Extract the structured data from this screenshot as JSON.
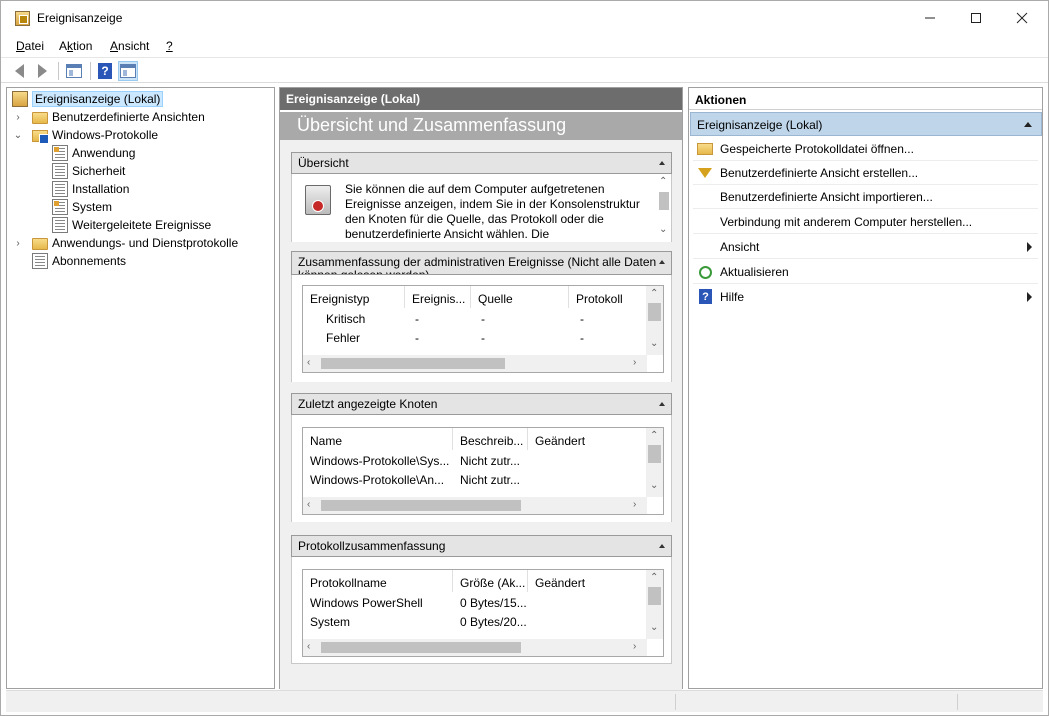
{
  "window": {
    "title": "Ereignisanzeige"
  },
  "menu": {
    "items": [
      {
        "label": "Datei",
        "ul": "D"
      },
      {
        "label": "Aktion",
        "ul": "k"
      },
      {
        "label": "Ansicht",
        "ul": "A"
      },
      {
        "label": "?",
        "ul": "?"
      }
    ]
  },
  "toolbar": {
    "icons": [
      "back-arrow-icon",
      "forward-arrow-icon",
      "show-hide-console-tree-icon",
      "help-icon",
      "show-hide-action-pane-icon"
    ]
  },
  "tree": {
    "root": "Ereignisanzeige (Lokal)",
    "custom_views": "Benutzerdefinierte Ansichten",
    "windows_logs": "Windows-Protokolle",
    "logs": [
      "Anwendung",
      "Sicherheit",
      "Installation",
      "System",
      "Weitergeleitete Ereignisse"
    ],
    "app_service_logs": "Anwendungs- und Dienstprotokolle",
    "subscriptions": "Abonnements"
  },
  "middle": {
    "header": "Ereignisanzeige (Lokal)",
    "title": "Übersicht und Zusammenfassung",
    "overview": {
      "title": "Übersicht",
      "text": "Sie können die auf dem Computer aufgetretenen Ereignisse anzeigen, indem Sie in der Konsolenstruktur den Knoten für die Quelle, das Protokoll oder die benutzerdefinierte Ansicht wählen. Die"
    },
    "admin_summary": {
      "title": "Zusammenfassung der administrativen Ereignisse (Nicht alle Daten können gelesen werden)",
      "columns": [
        "Ereignistyp",
        "Ereignis...",
        "Quelle",
        "Protokoll"
      ],
      "rows": [
        [
          "Kritisch",
          "-",
          "-",
          "-"
        ],
        [
          "Fehler",
          "-",
          "-",
          "-"
        ]
      ]
    },
    "recent_nodes": {
      "title": "Zuletzt angezeigte Knoten",
      "columns": [
        "Name",
        "Beschreib...",
        "Geändert"
      ],
      "rows": [
        [
          "Windows-Protokolle\\Sys...",
          "Nicht zutr...",
          ""
        ],
        [
          "Windows-Protokolle\\An...",
          "Nicht zutr...",
          ""
        ]
      ]
    },
    "log_summary": {
      "title": "Protokollzusammenfassung",
      "columns": [
        "Protokollname",
        "Größe (Ak...",
        "Geändert"
      ],
      "rows": [
        [
          "Windows PowerShell",
          "0 Bytes/15...",
          ""
        ],
        [
          "System",
          "0 Bytes/20...",
          ""
        ]
      ]
    }
  },
  "actions": {
    "header": "Aktionen",
    "group": "Ereignisanzeige (Lokal)",
    "items": [
      {
        "label": "Gespeicherte Protokolldatei öffnen...",
        "icon": "open-folder-icon",
        "submenu": false
      },
      {
        "label": "Benutzerdefinierte Ansicht erstellen...",
        "icon": "filter-icon",
        "submenu": false
      },
      {
        "label": "Benutzerdefinierte Ansicht importieren...",
        "icon": "",
        "submenu": false
      },
      {
        "label": "Verbindung mit anderem Computer herstellen...",
        "icon": "",
        "submenu": false
      },
      {
        "label": "Ansicht",
        "icon": "",
        "submenu": true
      },
      {
        "label": "Aktualisieren",
        "icon": "refresh-icon",
        "submenu": false
      },
      {
        "label": "Hilfe",
        "icon": "help-icon",
        "submenu": true
      }
    ]
  }
}
